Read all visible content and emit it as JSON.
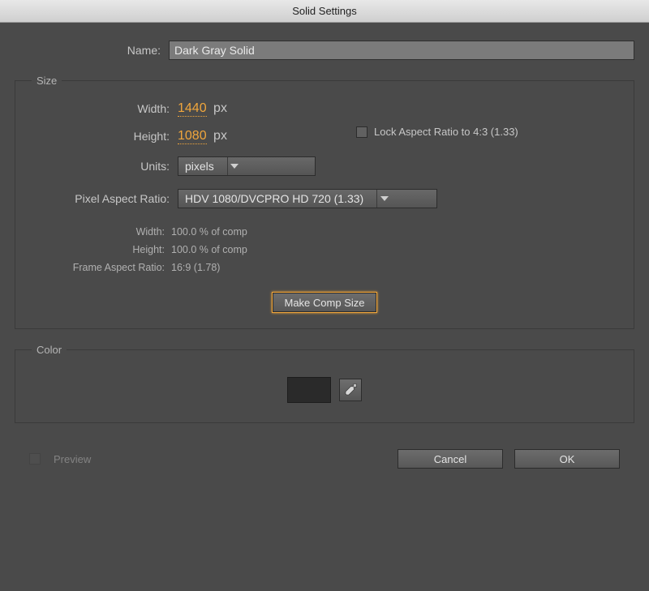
{
  "window": {
    "title": "Solid Settings"
  },
  "name": {
    "label": "Name:",
    "value": "Dark Gray Solid"
  },
  "size": {
    "legend": "Size",
    "width_label": "Width:",
    "width_value": "1440",
    "height_label": "Height:",
    "height_value": "1080",
    "px_unit": "px",
    "lock_label": "Lock Aspect Ratio to 4:3 (1.33)",
    "lock_checked": false,
    "units_label": "Units:",
    "units_value": "pixels",
    "par_label": "Pixel Aspect Ratio:",
    "par_value": "HDV 1080/DVCPRO HD 720 (1.33)",
    "info": {
      "width_label": "Width:",
      "width_value": "100.0 % of comp",
      "height_label": "Height:",
      "height_value": "100.0 % of comp",
      "far_label": "Frame Aspect Ratio:",
      "far_value": "16:9 (1.78)"
    },
    "make_comp_label": "Make Comp Size"
  },
  "color": {
    "legend": "Color",
    "swatch_hex": "#2a2a2a"
  },
  "footer": {
    "preview_label": "Preview",
    "preview_enabled": false,
    "cancel_label": "Cancel",
    "ok_label": "OK"
  }
}
